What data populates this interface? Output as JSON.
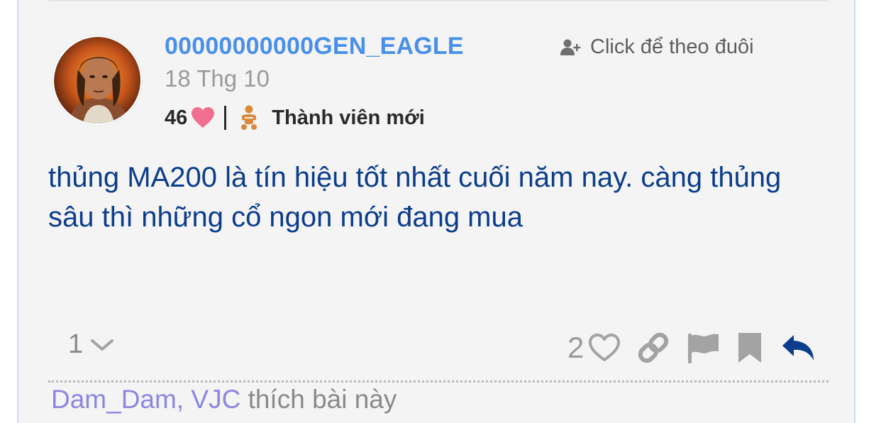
{
  "post": {
    "username": "00000000000GEN_EAGLE",
    "follow_label": "Click để theo đuôi",
    "date": "18 Thg 10",
    "user_likes": "46",
    "rank": "Thành viên mới",
    "body": "thủng MA200 là tín hiệu tốt nhất cuối năm nay. càng thủng sâu thì những cổ ngon mới đang mua",
    "reply_count": "1",
    "like_count": "2",
    "liked_by": [
      "Dam_Dam",
      "VJC"
    ],
    "liked_by_separator": ",",
    "liked_by_suffix": "thích bài này"
  },
  "icons": {
    "follow": "user-plus-icon",
    "heart": "heart-icon",
    "rank": "baby-icon",
    "expand": "chevron-down-icon",
    "like": "heart-outline-icon",
    "link": "link-icon",
    "flag": "flag-icon",
    "bookmark": "bookmark-icon",
    "reply": "reply-icon"
  },
  "colors": {
    "username": "#4a90e8",
    "body_text": "#0b3d8c",
    "heart": "#f06f8e",
    "rank_icon": "#d8893a",
    "reply_icon": "#0b3d8c",
    "liked_user": "#8c86e0"
  }
}
